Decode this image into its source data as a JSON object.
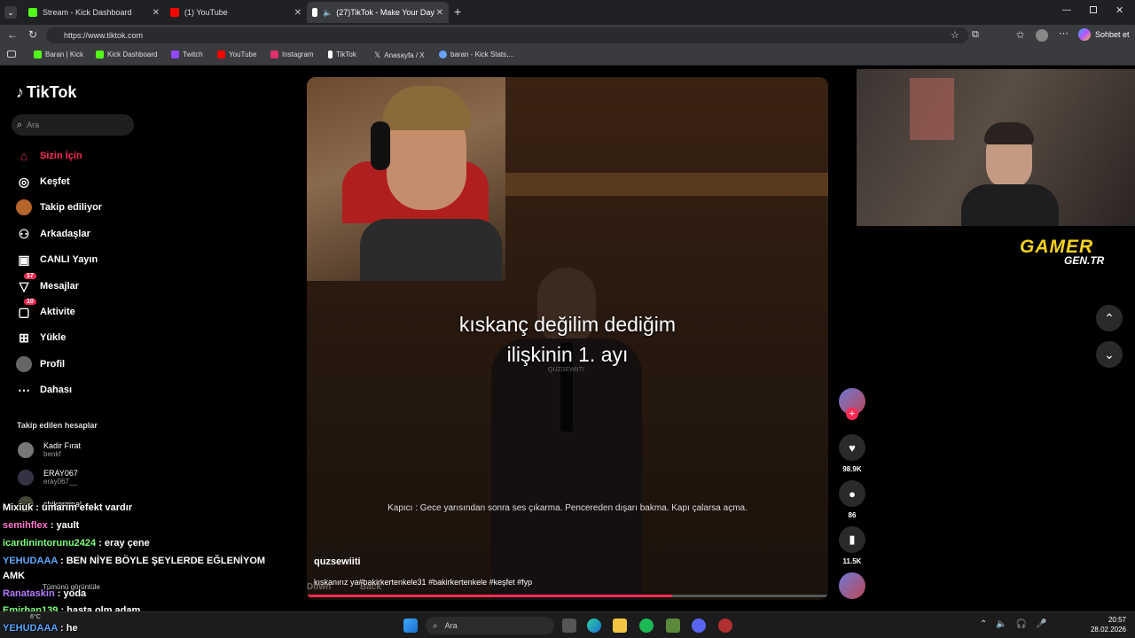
{
  "browser": {
    "tabs": [
      {
        "title": "Stream - Kick Dashboard",
        "fav": "#53fc18"
      },
      {
        "title": "(1) YouTube",
        "fav": "#ff0000"
      },
      {
        "title": "(27)TikTok - Make Your Day",
        "fav": "#ffffff"
      }
    ],
    "url": "https://www.tiktok.com",
    "profile_label": "Sohbet et",
    "bookmarks": [
      {
        "label": "Baran | Kick",
        "color": "#53fc18"
      },
      {
        "label": "Kick Dashboard",
        "color": "#53fc18"
      },
      {
        "label": "Twitch",
        "color": "#9146ff"
      },
      {
        "label": "YouTube",
        "color": "#ff0000"
      },
      {
        "label": "Instagram",
        "color": "#e1306c"
      },
      {
        "label": "TikTok",
        "color": "#ffffff"
      },
      {
        "label": "Anasayfa / X",
        "color": "#ffffff"
      },
      {
        "label": "baran - Kick Stats,...",
        "color": "#6aa0ff"
      }
    ]
  },
  "tiktok": {
    "logo": "TikTok",
    "search_placeholder": "Ara",
    "nav": [
      {
        "label": "Sizin İçin",
        "icon": "home-icon",
        "active": true
      },
      {
        "label": "Keşfet",
        "icon": "compass-icon"
      },
      {
        "label": "Takip ediliyor",
        "icon": "avatar-icon"
      },
      {
        "label": "Arkadaşlar",
        "icon": "friends-icon"
      },
      {
        "label": "CANLI Yayın",
        "icon": "live-icon"
      },
      {
        "label": "Mesajlar",
        "icon": "message-icon",
        "badge": "17"
      },
      {
        "label": "Aktivite",
        "icon": "activity-icon",
        "badge": "10"
      },
      {
        "label": "Yükle",
        "icon": "upload-icon"
      },
      {
        "label": "Profil",
        "icon": "profile-icon"
      },
      {
        "label": "Dahası",
        "icon": "more-icon"
      }
    ],
    "following_title": "Takip edilen hesaplar",
    "following": [
      {
        "name": "Kadir Fırat",
        "handle": "benkf"
      },
      {
        "name": "ERAY067",
        "handle": "eray067__"
      },
      {
        "name": "chikorginal",
        "handle": ""
      }
    ],
    "see_all": "Tümünü görüntüle",
    "video": {
      "caption_line1": "kıskanç değilim dediğim",
      "caption_line2": "ilişkinin 1. ayı",
      "subtitle": "Kapıcı : Gece yarısından sonra ses çıkarma. Pencereden dışarı bakma. Kapı çalarsa açma.",
      "author": "quzsewiiti",
      "description": "kıskanırız ya#bakirkertenkele31 #bakirkertenkele #keşfet #fyp",
      "hint": "Down",
      "hint2": "Back",
      "watermark": "QUZSEWIITI"
    },
    "actions": {
      "likes": "98.9K",
      "comments": "86",
      "saves": "11.5K"
    }
  },
  "overlay": {
    "gamer_logo": "GAMER",
    "gamer_sub": "GEN.TR",
    "chat": [
      {
        "user": "Mixiuk",
        "msg": ": umarım efekt vardır",
        "color": "#ffffff"
      },
      {
        "user": "semihflex",
        "msg": ": yault",
        "color": "#ff77cc"
      },
      {
        "user": "icardinintorunu2424",
        "msg": ": eray çene",
        "color": "#7cff7c"
      },
      {
        "user": "YEHUDAAA",
        "msg": ": BEN NİYE BÖYLE ŞEYLERDE EĞLENİYOM",
        "color": "#5aa8ff"
      },
      {
        "user": "",
        "msg": "AMK",
        "color": "#ffffff"
      },
      {
        "user": "Ranataskin",
        "msg": ": yoda",
        "color": "#b47cff"
      },
      {
        "user": "Emirhan139",
        "msg": ": hasta olm adam",
        "color": "#7cff7c"
      },
      {
        "user": "YEHUDAAA",
        "msg": ": he",
        "color": "#5aa8ff"
      }
    ]
  },
  "taskbar": {
    "search": "Ara",
    "weather": "6°C",
    "time": "20:57",
    "date": "28.02.2026"
  }
}
